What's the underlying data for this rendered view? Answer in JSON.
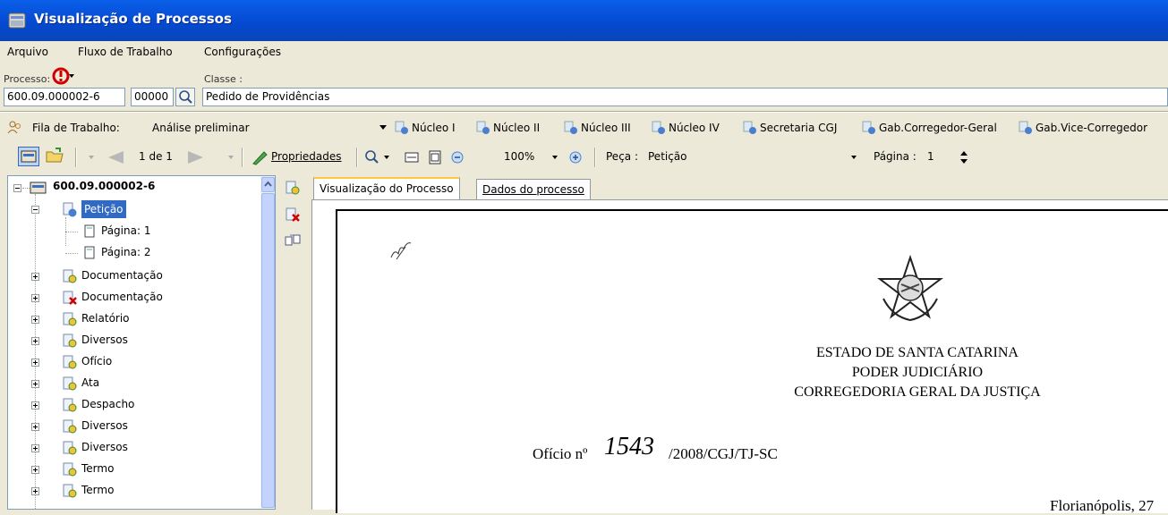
{
  "window": {
    "title": "Visualização de Processos"
  },
  "menu": {
    "items": [
      "Arquivo",
      "Fluxo de Trabalho",
      "Configurações"
    ]
  },
  "process": {
    "process_label": "Processo:",
    "class_label": "Classe :",
    "number": "600.09.000002-6",
    "seq": "00000",
    "class_value": "Pedido de Providências"
  },
  "queue": {
    "label": "Fila de Trabalho:",
    "value": "Análise preliminar",
    "units": [
      "Núcleo I",
      "Núcleo II",
      "Núcleo III",
      "Núcleo IV",
      "Secretaria CGJ",
      "Gab.Corregedor-Geral",
      "Gab.Vice-Corregedor"
    ]
  },
  "toolbar": {
    "pager": "1 de 1",
    "properties": "Propriedades",
    "zoom": "100%",
    "piece_label": "Peça :",
    "piece_value": "Petição",
    "page_label": "Página :",
    "page_value": "1"
  },
  "tree": {
    "root": "600.09.000002-6",
    "items": [
      {
        "label": "Petição",
        "selected": true,
        "expanded": true
      },
      {
        "label": "Página: 1"
      },
      {
        "label": "Página: 2"
      },
      {
        "label": "Documentação"
      },
      {
        "label": "Documentação",
        "icon": "red-x"
      },
      {
        "label": "Relatório"
      },
      {
        "label": "Diversos"
      },
      {
        "label": "Ofício"
      },
      {
        "label": "Ata"
      },
      {
        "label": "Despacho"
      },
      {
        "label": "Diversos"
      },
      {
        "label": "Diversos"
      },
      {
        "label": "Termo"
      },
      {
        "label": "Termo"
      }
    ]
  },
  "tabs": [
    {
      "label": "Visualização do Processo",
      "active": true
    },
    {
      "label": "Dados do processo",
      "active": false
    }
  ],
  "document": {
    "line1": "ESTADO DE SANTA CATARINA",
    "line2": "PODER JUDICIÁRIO",
    "line3": "CORREGEDORIA GERAL DA JUSTIÇA",
    "oficio_prefix": "Ofício nº",
    "oficio_number": "1543",
    "oficio_suffix": "/2008/CGJ/TJ-SC",
    "city_date": "Florianópolis, 27"
  }
}
